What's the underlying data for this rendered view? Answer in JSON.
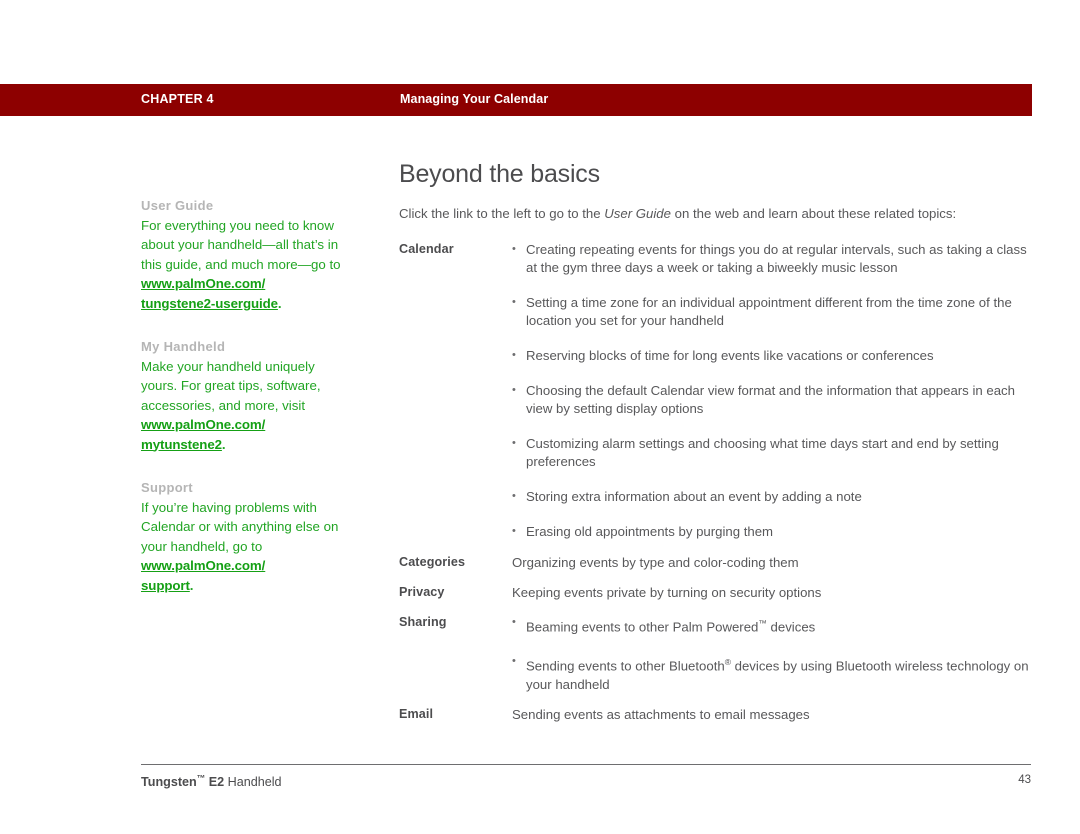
{
  "header": {
    "chapter_label": "CHAPTER 4",
    "chapter_title": "Managing Your Calendar",
    "bar_color": "#8d0000"
  },
  "sidebar": {
    "blocks": [
      {
        "heading": "User Guide",
        "body": "For everything you need to know about your handheld—all that’s in this guide, and much more—go to",
        "link_line1": "www.palmOne.com/",
        "link_line2": "tungstene2-userguide",
        "link_tail": "."
      },
      {
        "heading": "My Handheld",
        "body": "Make your handheld uniquely yours. For great tips, software, accessories, and more, visit",
        "link_line1": "www.palmOne.com/",
        "link_line2": "mytunstene2",
        "link_tail": "."
      },
      {
        "heading": "Support",
        "body": "If you’re having problems with Calendar or with anything else on your handheld, go to",
        "link_line1": "www.palmOne.com/",
        "link_line2": "support",
        "link_tail": "."
      }
    ],
    "heading_color": "#b5b5b5",
    "link_color": "#15a015"
  },
  "main": {
    "title": "Beyond the basics",
    "intro_before": "Click the link to the left to go to the ",
    "intro_italic": "User Guide",
    "intro_after": " on the web and learn about these related topics:",
    "topics": [
      {
        "label": "Calendar",
        "items": [
          {
            "bullet": true,
            "text": "Creating repeating events for things you do at regular intervals, such as taking a class at the gym three days a week or taking a biweekly music lesson"
          },
          {
            "bullet": true,
            "text": "Setting a time zone for an individual appointment different from the time zone of the location you set for your handheld"
          },
          {
            "bullet": true,
            "text": "Reserving blocks of time for long events like vacations or conferences"
          },
          {
            "bullet": true,
            "text": "Choosing the default Calendar view format and the information that appears in each view by setting display options"
          },
          {
            "bullet": true,
            "text": "Customizing alarm settings and choosing what time days start and end by setting preferences"
          },
          {
            "bullet": true,
            "text": "Storing extra information about an event by adding a note"
          },
          {
            "bullet": true,
            "text": "Erasing old appointments by purging them"
          }
        ]
      },
      {
        "label": "Categories",
        "items": [
          {
            "bullet": false,
            "text": "Organizing events by type and color-coding them"
          }
        ]
      },
      {
        "label": "Privacy",
        "items": [
          {
            "bullet": false,
            "text": "Keeping events private by turning on security options"
          }
        ]
      },
      {
        "label": "Sharing",
        "items": [
          {
            "bullet": true,
            "text": "Beaming events to other Palm Powered™ devices",
            "html": true
          },
          {
            "bullet": true,
            "text": "Sending events to other Bluetooth® devices by using Bluetooth wireless technology on your handheld",
            "html": true
          }
        ]
      },
      {
        "label": "Email",
        "items": [
          {
            "bullet": false,
            "text": "Sending events as attachments to email messages"
          }
        ]
      }
    ]
  },
  "footer": {
    "product_bold": "Tungsten™ E2",
    "product_rest": " Handheld",
    "page_number": "43"
  }
}
